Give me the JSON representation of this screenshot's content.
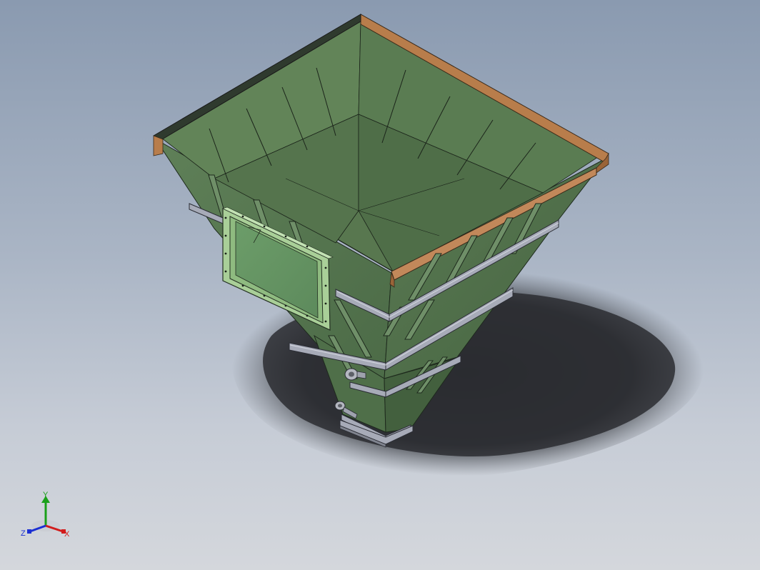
{
  "viewport": {
    "background_top": "#8a9ab0",
    "background_bottom": "#d4d7dc"
  },
  "model": {
    "name": "hopper",
    "body_color": "#5b7a55",
    "inner_color": "#58774f",
    "rim_color": "#b87d4b",
    "steel_color": "#a7abb8",
    "window_frame_color": "#a9cf98",
    "shadow_color": "#2d2f33"
  },
  "triad": {
    "x_label": "X",
    "y_label": "Y",
    "z_label": "Z",
    "x_color": "#d21b1b",
    "y_color": "#1aa01a",
    "z_color": "#1b2fd2"
  }
}
